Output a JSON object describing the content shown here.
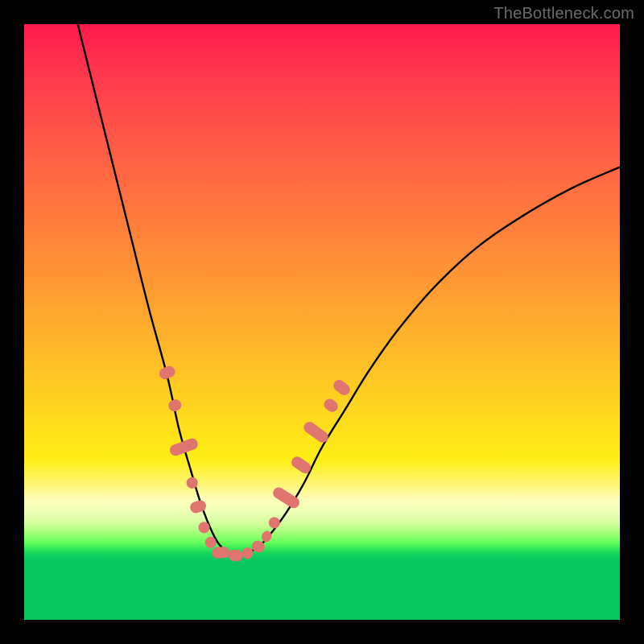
{
  "watermark": "TheBottleneck.com",
  "chart_data": {
    "type": "line",
    "title": "",
    "xlabel": "",
    "ylabel": "",
    "xlim": [
      0,
      100
    ],
    "ylim": [
      0,
      100
    ],
    "series": [
      {
        "name": "curve",
        "x": [
          9,
          12,
          15,
          18,
          21,
          24,
          26,
          28,
          29.5,
          31,
          32.5,
          34,
          35.5,
          37,
          39,
          41,
          44,
          47,
          50,
          54,
          58,
          63,
          69,
          76,
          84,
          92,
          100
        ],
        "values": [
          100,
          88,
          76,
          64,
          52,
          41,
          32,
          25,
          20,
          16,
          13,
          11.5,
          11,
          11.2,
          12,
          14,
          18,
          23,
          29,
          35.5,
          42,
          49,
          56,
          62.5,
          68,
          72.5,
          76
        ]
      }
    ],
    "markers": [
      {
        "path": "left",
        "x": 24.0,
        "y": 41.5,
        "len": 20,
        "angle": 68
      },
      {
        "path": "left",
        "x": 25.3,
        "y": 36.0,
        "len": 16,
        "angle": 68
      },
      {
        "path": "left",
        "x": 26.8,
        "y": 29.0,
        "len": 36,
        "angle": 70
      },
      {
        "path": "left",
        "x": 28.2,
        "y": 23.0,
        "len": 14,
        "angle": 71
      },
      {
        "path": "left",
        "x": 29.2,
        "y": 19.0,
        "len": 20,
        "angle": 72
      },
      {
        "path": "left",
        "x": 30.2,
        "y": 15.5,
        "len": 14,
        "angle": 74
      },
      {
        "path": "left",
        "x": 31.3,
        "y": 13.0,
        "len": 14,
        "angle": 78
      },
      {
        "path": "left",
        "x": 33.0,
        "y": 11.3,
        "len": 22,
        "angle": 86
      },
      {
        "path": "bottom",
        "x": 35.5,
        "y": 10.8,
        "len": 18,
        "angle": 95
      },
      {
        "path": "bottom",
        "x": 37.5,
        "y": 11.2,
        "len": 14,
        "angle": 100
      },
      {
        "path": "right",
        "x": 39.3,
        "y": 12.3,
        "len": 16,
        "angle": 108
      },
      {
        "path": "right",
        "x": 40.7,
        "y": 14.0,
        "len": 12,
        "angle": 114
      },
      {
        "path": "right",
        "x": 42.0,
        "y": 16.3,
        "len": 14,
        "angle": 118
      },
      {
        "path": "right",
        "x": 44.0,
        "y": 20.5,
        "len": 36,
        "angle": 122
      },
      {
        "path": "right",
        "x": 46.5,
        "y": 26.0,
        "len": 26,
        "angle": 124
      },
      {
        "path": "right",
        "x": 49.0,
        "y": 31.5,
        "len": 34,
        "angle": 126
      },
      {
        "path": "right",
        "x": 51.5,
        "y": 36.0,
        "len": 18,
        "angle": 127
      },
      {
        "path": "right",
        "x": 53.3,
        "y": 39.0,
        "len": 22,
        "angle": 128
      }
    ],
    "marker_color": "#e0746e",
    "curve_color": "#000000"
  }
}
